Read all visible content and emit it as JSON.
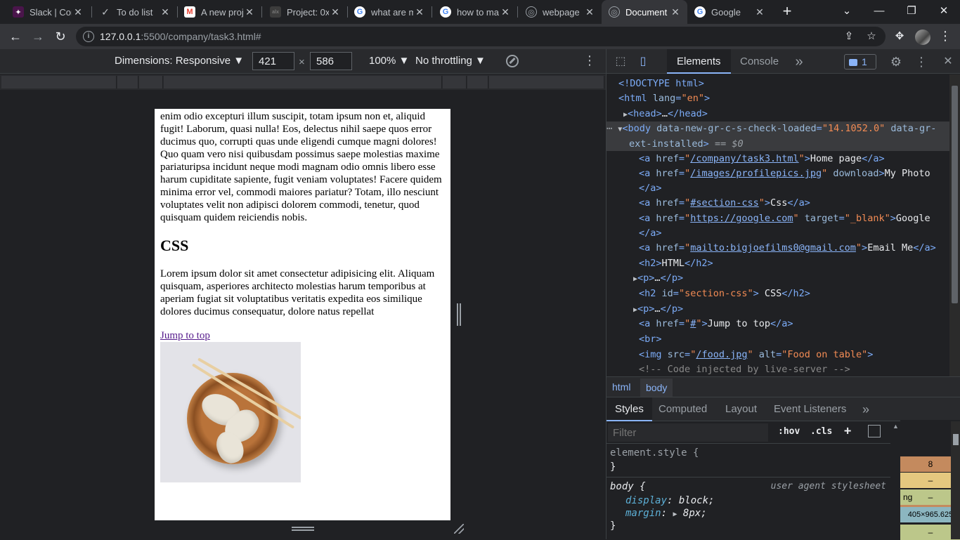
{
  "browser": {
    "tabs": [
      {
        "title": "Slack | Con",
        "icon": "slack-icon",
        "color": "#e01e5a"
      },
      {
        "title": "To do list",
        "icon": "checkmark-icon",
        "color": "#bdc1c6"
      },
      {
        "title": "A new proj",
        "icon": "gmail-icon",
        "color": "#ea4335"
      },
      {
        "title": "Project: 0x",
        "icon": "project-icon",
        "color": "#555"
      },
      {
        "title": "what are m",
        "icon": "google-icon",
        "color": "#4285f4"
      },
      {
        "title": "how to ma",
        "icon": "google-icon",
        "color": "#4285f4"
      },
      {
        "title": "webpage",
        "icon": "globe-icon",
        "color": "#9aa0a6"
      },
      {
        "title": "Document",
        "icon": "globe-icon",
        "color": "#9aa0a6",
        "active": true
      },
      {
        "title": "Google",
        "icon": "google-icon",
        "color": "#4285f4"
      }
    ],
    "url_host": "127.0.0.1",
    "url_rest": ":5500/company/task3.html#"
  },
  "device_toolbar": {
    "dimensions_label": "Dimensions: Responsive ▼",
    "width": "421",
    "times": "×",
    "height": "586",
    "zoom": "100% ▼",
    "throttling": "No throttling ▼"
  },
  "page": {
    "para1": "enim odio excepturi illum suscipit, totam ipsum non et, aliquid fugit! Laborum, quasi nulla! Eos, delectus nihil saepe quos error ducimus quo, corrupti quas unde eligendi cumque magni dolores! Quo quam vero nisi quibusdam possimus saepe molestias maxime pariaturipsa incidunt neque modi magnam odio omnis libero esse harum cupiditate sapiente, fugit veniam voluptates! Facere quidem minima error vel, commodi maiores pariatur? Totam, illo nesciunt voluptates velit non adipisci dolorem commodi, tenetur, quod quisquam quidem reiciendis nobis.",
    "heading_css": "CSS",
    "para2": "Lorem ipsum dolor sit amet consectetur adipisicing elit. Aliquam quisquam, asperiores architecto molestias harum temporibus at aperiam fugiat sit voluptatibus veritatis expedita eos similique dolores ducimus consequatur, dolore natus repellat",
    "jump_link": "Jump to top"
  },
  "devtools": {
    "tab_elements": "Elements",
    "tab_console": "Console",
    "more_tabs": "»",
    "issues_count": "1",
    "crumb_html": "html",
    "crumb_body": "body",
    "style_tabs": [
      "Styles",
      "Computed",
      "Layout",
      "Event Listeners",
      "»"
    ],
    "filter_placeholder": "Filter",
    "hov": ":hov",
    "cls": ".cls",
    "element_style": "element.style {",
    "close_brace": "}",
    "body_selector": "body {",
    "ua_source": "user agent stylesheet",
    "prop_display": "display",
    "val_display": "block;",
    "prop_margin": "margin",
    "val_margin": "8px;",
    "boxmodel": [
      "8",
      "–",
      "ng",
      "–",
      "405×965.625",
      "–"
    ]
  }
}
